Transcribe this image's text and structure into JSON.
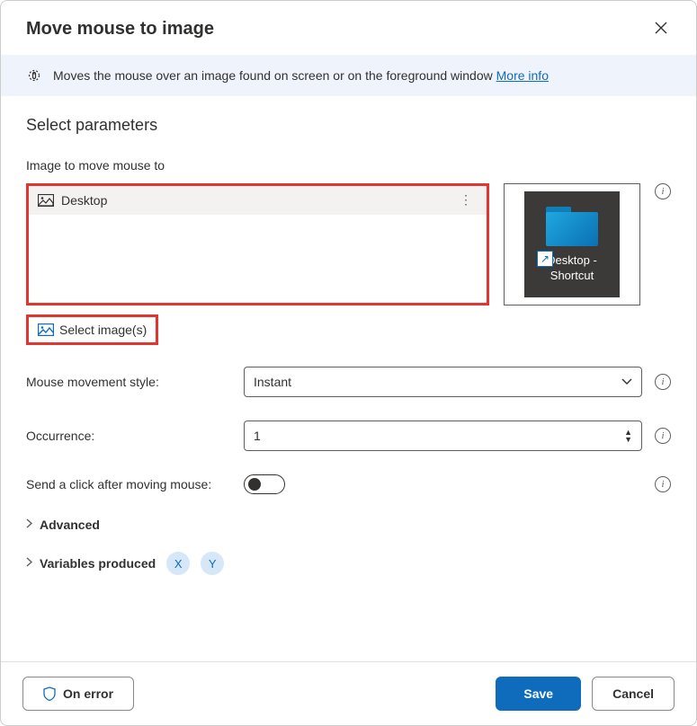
{
  "dialog": {
    "title": "Move mouse to image"
  },
  "banner": {
    "text": "Moves the mouse over an image found on screen or on the foreground window ",
    "more_info": "More info"
  },
  "section": {
    "title": "Select parameters",
    "image_label": "Image to move mouse to"
  },
  "image_list": {
    "items": [
      {
        "name": "Desktop"
      }
    ]
  },
  "preview": {
    "label": "Desktop -\nShortcut"
  },
  "select_images_label": "Select image(s)",
  "fields": {
    "movement_label": "Mouse movement style:",
    "movement_value": "Instant",
    "occurrence_label": "Occurrence:",
    "occurrence_value": "1",
    "send_click_label": "Send a click after moving mouse:",
    "send_click_value": false
  },
  "expanders": {
    "advanced": "Advanced",
    "variables": "Variables produced",
    "var_x": "X",
    "var_y": "Y"
  },
  "footer": {
    "on_error": "On error",
    "save": "Save",
    "cancel": "Cancel"
  }
}
